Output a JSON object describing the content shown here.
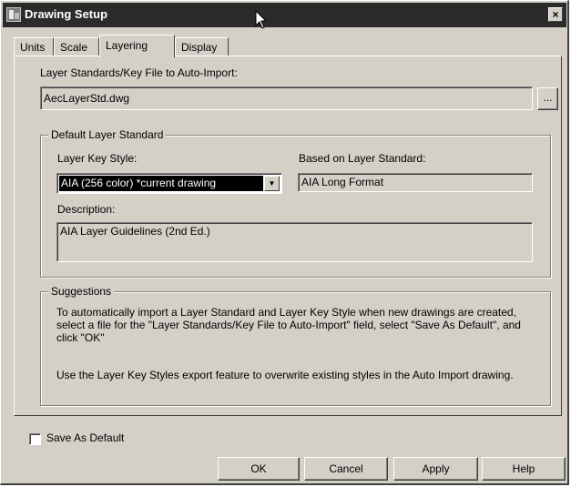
{
  "window": {
    "title": "Drawing Setup",
    "close_label": "×"
  },
  "tabs": [
    {
      "label": "Units"
    },
    {
      "label": "Scale"
    },
    {
      "label": "Layering",
      "active": true
    },
    {
      "label": "Display"
    }
  ],
  "layering": {
    "auto_import_label": "Layer Standards/Key File to Auto-Import:",
    "auto_import_value": "AecLayerStd.dwg",
    "browse_label": "...",
    "default_group_title": "Default Layer Standard",
    "key_style_label": "Layer Key Style:",
    "key_style_value": "AIA (256 color) *current drawing",
    "based_on_label": "Based on Layer Standard:",
    "based_on_value": "AIA Long Format",
    "description_label": "Description:",
    "description_value": "AIA Layer Guidelines (2nd Ed.)",
    "suggestions_title": "Suggestions",
    "suggestion_1": "To automatically import a Layer Standard and Layer Key Style when new drawings are created, select a file for the \"Layer Standards/Key File to Auto-Import\" field, select \"Save As Default\", and click \"OK\"",
    "suggestion_2": "Use the Layer Key Styles export feature to overwrite existing styles in the Auto Import drawing."
  },
  "footer": {
    "save_default_label": "Save As Default",
    "ok_label": "OK",
    "cancel_label": "Cancel",
    "apply_label": "Apply",
    "help_label": "Help"
  },
  "icons": {
    "app": "autocad-app-icon",
    "close": "close-icon",
    "dropdown": "chevron-down-icon",
    "cursor": "mouse-pointer-icon"
  }
}
